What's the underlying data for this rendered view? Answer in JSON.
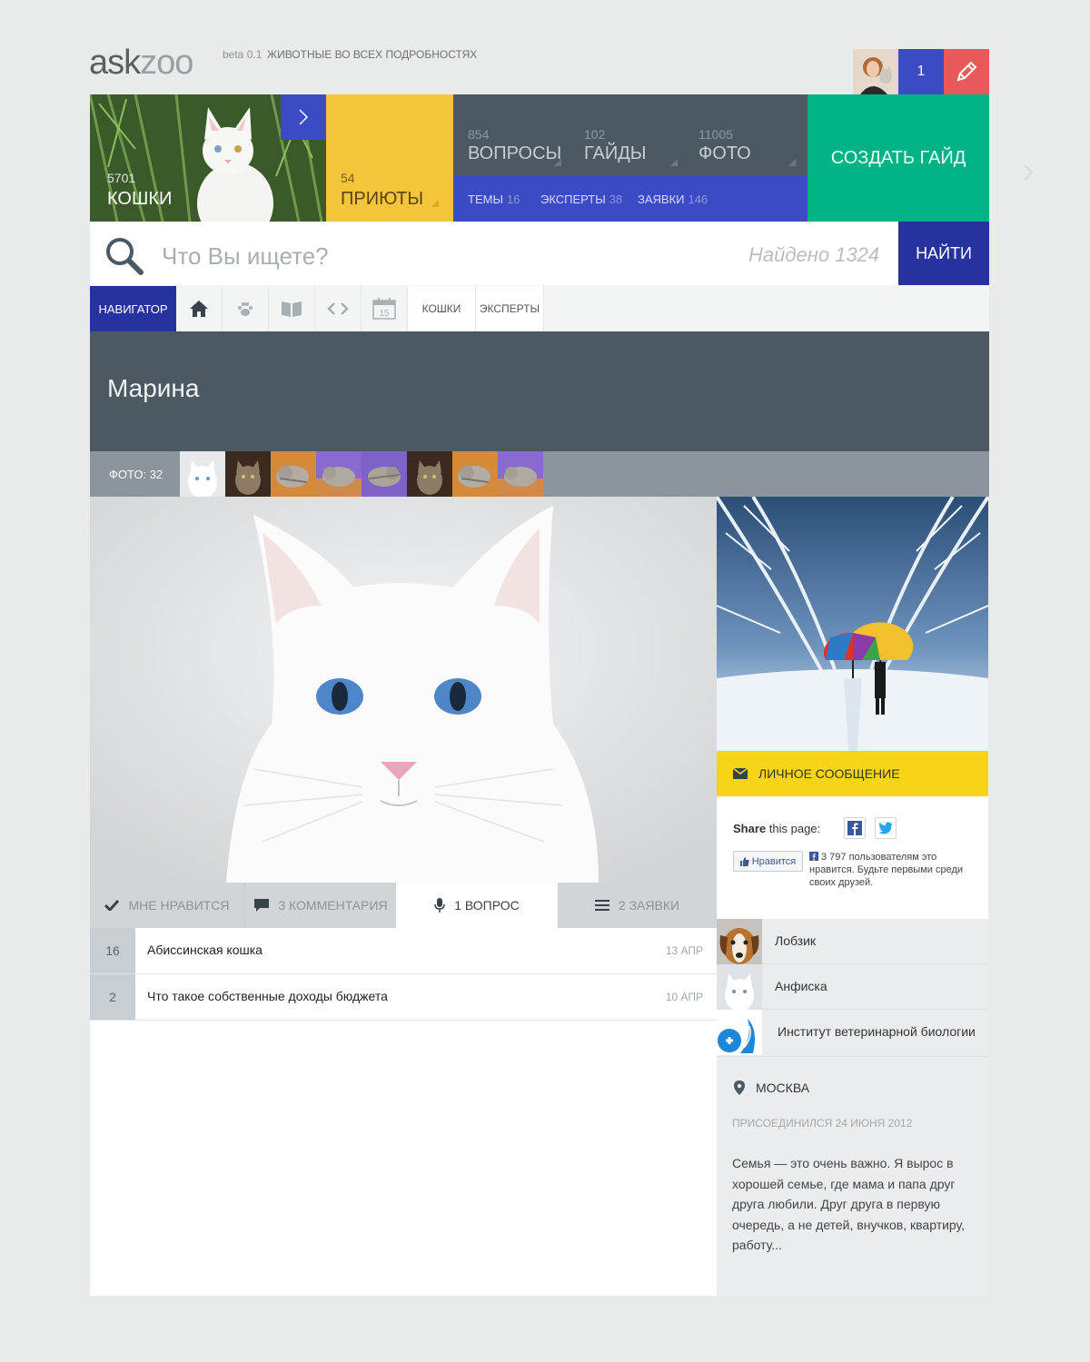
{
  "header": {
    "logo_a": "ask",
    "logo_b": "zoo",
    "beta": "beta 0.1",
    "tagline": "ЖИВОТНЫЕ ВО ВСЕХ ПОДРОБНОСТЯХ",
    "notifications": "1"
  },
  "tiles": {
    "cats": {
      "count": "5701",
      "label": "КОШКИ"
    },
    "shelters": {
      "count": "54",
      "label": "ПРИЮТЫ"
    },
    "stats": [
      {
        "count": "854",
        "label": "ВОПРОСЫ"
      },
      {
        "count": "102",
        "label": "ГАЙДЫ"
      },
      {
        "count": "11005",
        "label": "ФОТО"
      }
    ],
    "sub": [
      {
        "label": "ТЕМЫ",
        "count": "16"
      },
      {
        "label": "ЭКСПЕРТЫ",
        "count": "38"
      },
      {
        "label": "ЗАЯВКИ",
        "count": "146"
      }
    ],
    "create": "СОЗДАТЬ ГАЙД"
  },
  "search": {
    "placeholder": "Что Вы ищете?",
    "found": "Найдено 1324",
    "button": "НАЙТИ"
  },
  "navigator": {
    "label": "НАВИГАТОР",
    "links": [
      "КОШКИ",
      "ЭКСПЕРТЫ"
    ],
    "calendar_day": "15"
  },
  "profile": {
    "name": "Марина",
    "photo_count": "ФОТО: 32"
  },
  "tabs": [
    {
      "label": "МНЕ НРАВИТСЯ",
      "icon": "check-icon"
    },
    {
      "label": "3 КОММЕНТАРИЯ",
      "icon": "comment-icon"
    },
    {
      "label": "1 ВОПРОС",
      "icon": "microphone-icon"
    },
    {
      "label": "2 ЗАЯВКИ",
      "icon": "list-icon"
    }
  ],
  "questions": [
    {
      "count": "16",
      "title": "Абиссинская кошка",
      "date": "13 АПР"
    },
    {
      "count": "2",
      "title": "Что такое собственные доходы бюджета",
      "date": "10 АПР"
    }
  ],
  "sidebar": {
    "message_button": "ЛИЧНОЕ СООБЩЕНИЕ",
    "share_bold": "Share",
    "share_rest": "this page:",
    "like_button": "Нравится",
    "like_text": "3 797 пользователям это нравится. Будьте первыми среди своих друзей.",
    "friends": [
      "Лобзик",
      "Анфиска",
      "Институт ветеринарной биологии"
    ],
    "location": "МОСКВА",
    "joined": "ПРИСОЕДИНИЛСЯ 24 ИЮНЯ 2012",
    "bio": "Семья — это очень важно. Я вырос в хорошей семье, где мама и папа друг друга любили. Друг друга в первую очередь, а не детей, внучков, квартиру, работу..."
  },
  "colors": {
    "blue": "#3a4bc4",
    "dark_blue": "#26329d",
    "yellow": "#f4c53b",
    "green": "#00b386",
    "slate": "#4c5962",
    "red": "#e8595a",
    "message_yellow": "#f7d516"
  }
}
